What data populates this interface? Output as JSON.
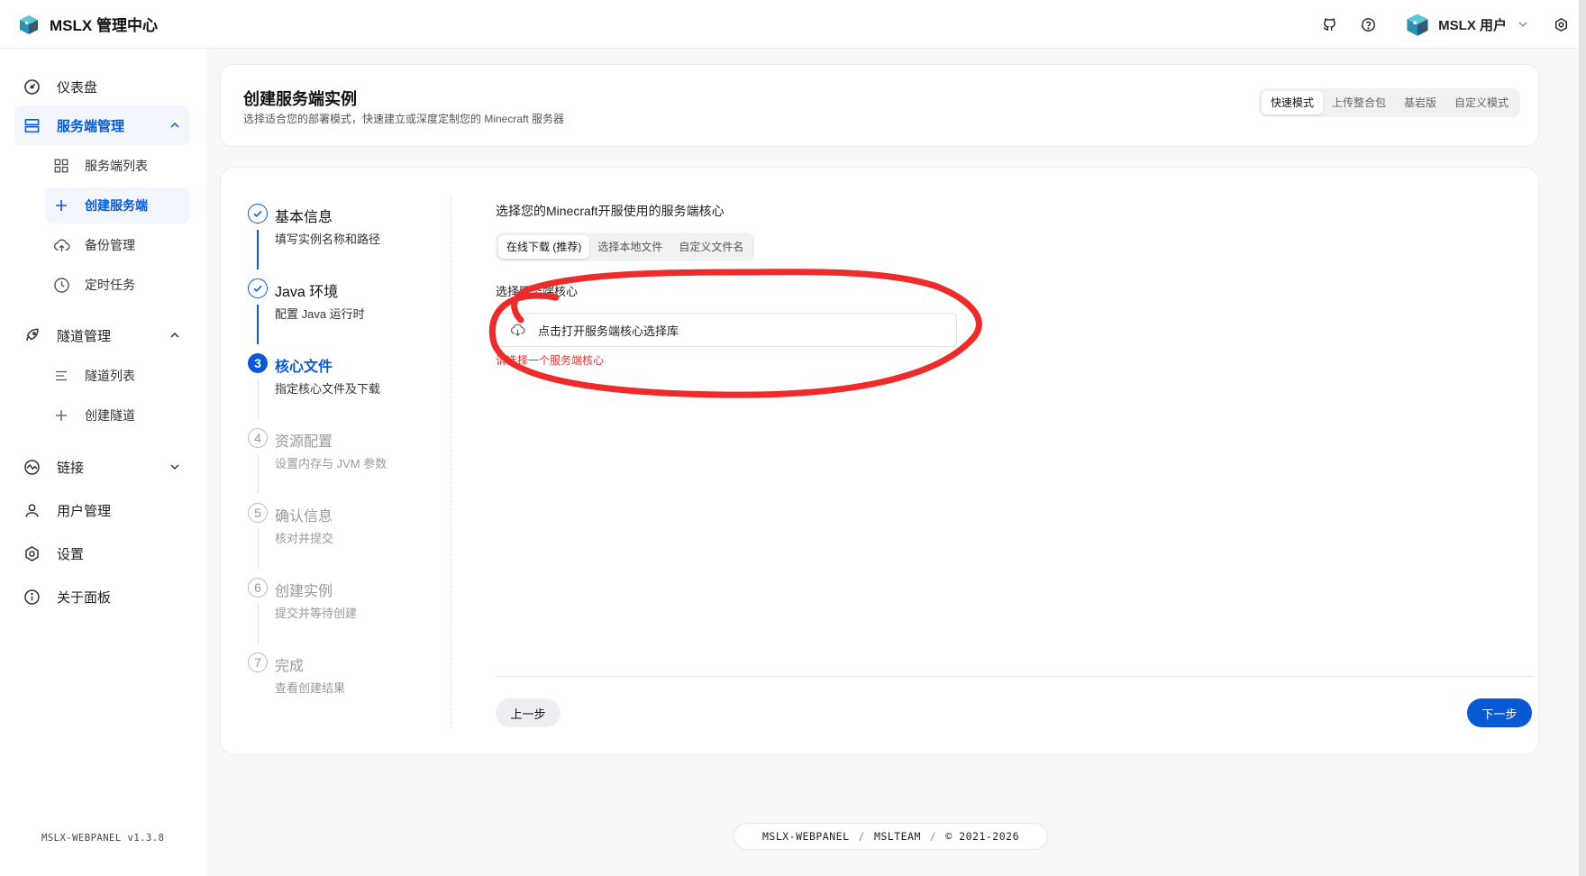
{
  "app": {
    "title": "MSLX 管理中心",
    "user_name": "MSLX 用户",
    "version": "MSLX-WEBPANEL v1.3.8"
  },
  "colors": {
    "accent": "#0a59d4",
    "error": "#e03636",
    "annotation": "#ee2b2b"
  },
  "sidebar": {
    "items": [
      {
        "label": "仪表盘",
        "icon": "dashboard-icon"
      },
      {
        "label": "服务端管理",
        "icon": "server-icon",
        "expanded": true
      },
      {
        "label": "服务端列表",
        "icon": "grid-icon"
      },
      {
        "label": "创建服务端",
        "icon": "plus-icon",
        "active": true
      },
      {
        "label": "备份管理",
        "icon": "cloud-upload-icon"
      },
      {
        "label": "定时任务",
        "icon": "clock-icon"
      },
      {
        "label": "隧道管理",
        "icon": "rocket-icon",
        "expanded": true
      },
      {
        "label": "隧道列表",
        "icon": "list-icon"
      },
      {
        "label": "创建隧道",
        "icon": "plus-icon"
      },
      {
        "label": "链接",
        "icon": "link-icon",
        "expanded": false
      },
      {
        "label": "用户管理",
        "icon": "user-icon"
      },
      {
        "label": "设置",
        "icon": "settings-icon"
      },
      {
        "label": "关于面板",
        "icon": "info-icon"
      }
    ]
  },
  "header": {
    "title": "创建服务端实例",
    "subtitle": "选择适合您的部署模式，快速建立或深度定制您的 Minecraft 服务器",
    "modes": [
      {
        "label": "快速模式",
        "active": true
      },
      {
        "label": "上传整合包"
      },
      {
        "label": "基岩版"
      },
      {
        "label": "自定义模式"
      }
    ]
  },
  "steps": [
    {
      "number": "1",
      "title": "基本信息",
      "desc": "填写实例名称和路径",
      "state": "done"
    },
    {
      "number": "2",
      "title": "Java 环境",
      "desc": "配置 Java 运行时",
      "state": "done"
    },
    {
      "number": "3",
      "title": "核心文件",
      "desc": "指定核心文件及下载",
      "state": "current"
    },
    {
      "number": "4",
      "title": "资源配置",
      "desc": "设置内存与 JVM 参数",
      "state": "todo"
    },
    {
      "number": "5",
      "title": "确认信息",
      "desc": "核对并提交",
      "state": "todo"
    },
    {
      "number": "6",
      "title": "创建实例",
      "desc": "提交并等待创建",
      "state": "todo"
    },
    {
      "number": "7",
      "title": "完成",
      "desc": "查看创建结果",
      "state": "todo"
    }
  ],
  "form": {
    "section_label": "选择您的Minecraft开服使用的服务端核心",
    "source_tabs": [
      {
        "label": "在线下载 (推荐)",
        "active": true
      },
      {
        "label": "选择本地文件"
      },
      {
        "label": "自定义文件名"
      }
    ],
    "core_label": "选择服务端核心",
    "core_picker_text": "点击打开服务端核心选择库",
    "core_error": "请选择一个服务端核心"
  },
  "buttons": {
    "prev": "上一步",
    "next": "下一步"
  },
  "footer": {
    "parts": [
      "MSLX-WEBPANEL",
      "MSLTEAM",
      "© 2021-2026"
    ],
    "separator": "/"
  }
}
